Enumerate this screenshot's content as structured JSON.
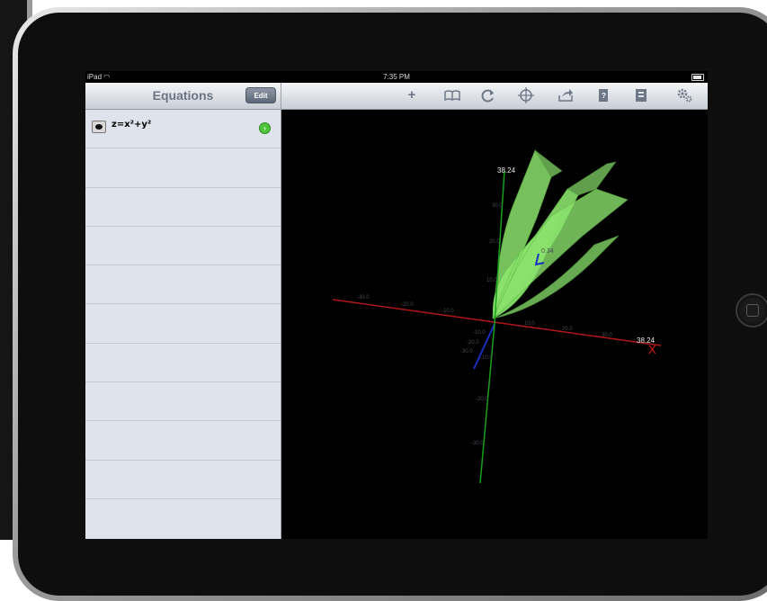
{
  "status_bar": {
    "carrier": "iPad",
    "time": "7:35 PM",
    "battery_level": 0.9
  },
  "left_panel": {
    "title": "Equations",
    "edit_label": "Edit",
    "equations": [
      {
        "text": "z=x²+y²",
        "visible": true
      }
    ]
  },
  "toolbar": {
    "icons": [
      "plus-icon",
      "book-icon",
      "refresh-icon",
      "target-icon",
      "share-icon",
      "clipboard-icon",
      "book-mark-icon",
      "gears-icon"
    ]
  },
  "graph": {
    "axis_max_label": "38.24",
    "x_axis_name": "X",
    "x_ticks": [
      "-30.0",
      "-20.0",
      "-10.0",
      "10.0",
      "20.0",
      "30.0"
    ],
    "z_ticks": [
      "30.0",
      "20.0",
      "10.0",
      "-10.0",
      "-20.0",
      "-30.0"
    ],
    "y_ticks": [
      "-10.0",
      "-20.0",
      "-30.0"
    ],
    "y_axis_tag": "0.34",
    "surface_color": "#8be36d",
    "x_axis_color": "#b01818",
    "z_axis_color": "#1aa01a",
    "y_axis_color": "#1a2fc0"
  }
}
